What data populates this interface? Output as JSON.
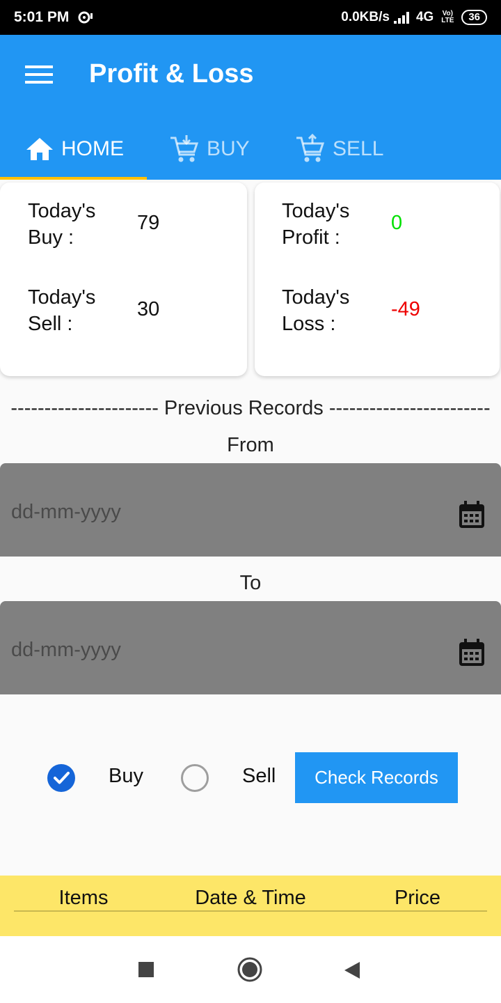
{
  "status_bar": {
    "time": "5:01 PM",
    "net_speed": "0.0KB/s",
    "network": "4G",
    "volte": "Vo) LTE",
    "battery": "36"
  },
  "app_bar": {
    "title": "Profit & Loss",
    "tabs": [
      {
        "label": "HOME",
        "icon": "home-icon",
        "active": true
      },
      {
        "label": "BUY",
        "icon": "cart-download-icon",
        "active": false
      },
      {
        "label": "SELL",
        "icon": "cart-upload-icon",
        "active": false
      }
    ],
    "indicator_color": "#ffc107"
  },
  "summary": {
    "buy_label": "Today's Buy :",
    "buy_value": "79",
    "sell_label": "Today's Sell :",
    "sell_value": "30",
    "profit_label": "Today's Profit :",
    "profit_value": "0",
    "loss_label": "Today's Loss :",
    "loss_value": "-49"
  },
  "records": {
    "heading": "---------------------- Previous Records ------------------------",
    "from_label": "From",
    "to_label": "To",
    "from_placeholder": "dd-mm-yyyy",
    "to_placeholder": "dd-mm-yyyy"
  },
  "options": {
    "buy_label": "Buy",
    "sell_label": "Sell",
    "selected": "Buy",
    "check_button": "Check Records"
  },
  "table": {
    "columns": [
      "Items",
      "Date & Time",
      "Price"
    ]
  },
  "colors": {
    "primary": "#2196f3",
    "profit": "#00e000",
    "loss": "#ee0000",
    "table_header": "#fde668"
  }
}
